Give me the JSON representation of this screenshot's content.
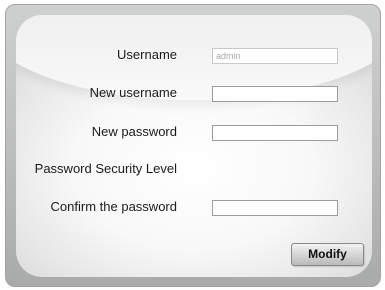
{
  "form": {
    "username_label": "Username",
    "username_value": "admin",
    "new_username_label": "New username",
    "new_username_value": "",
    "new_password_label": "New password",
    "new_password_value": "",
    "security_level_label": "Password Security Level",
    "confirm_password_label": "Confirm the password",
    "confirm_password_value": "",
    "modify_button_label": "Modify"
  }
}
